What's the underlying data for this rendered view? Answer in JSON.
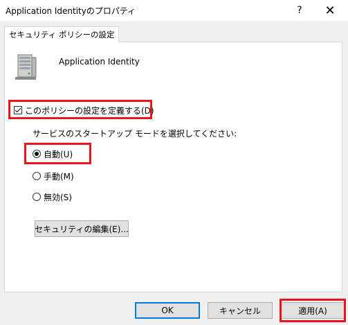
{
  "window": {
    "title": "Application Identityのプロパティ",
    "help_glyph": "?",
    "close_glyph": "✕"
  },
  "tab": {
    "label": "セキュリティ ポリシーの設定"
  },
  "service": {
    "name": "Application Identity",
    "icon": "server-icon"
  },
  "policy": {
    "define_label": "このポリシーの設定を定義する(D)",
    "define_checked": true,
    "prompt": "サービスのスタートアップ モードを選択してください:",
    "options": [
      {
        "label": "自動(U)",
        "selected": true
      },
      {
        "label": "手動(M)",
        "selected": false
      },
      {
        "label": "無効(S)",
        "selected": false
      }
    ],
    "security_button": "セキュリティの編集(E)..."
  },
  "buttons": {
    "ok": "OK",
    "cancel": "キャンセル",
    "apply": "適用(A)"
  },
  "colors": {
    "highlight": "#e8141b",
    "focus": "#0078d7"
  }
}
